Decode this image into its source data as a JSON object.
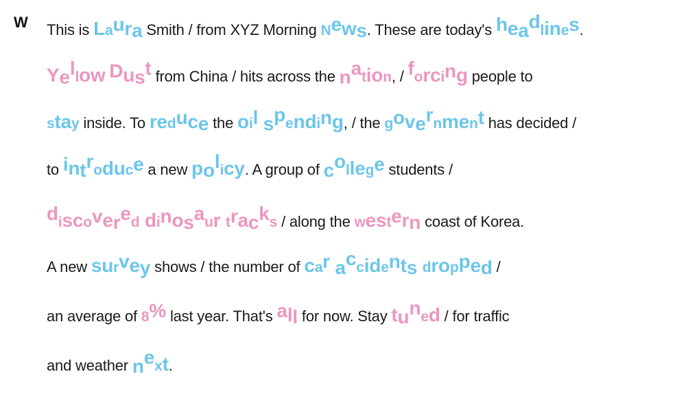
{
  "speaker": "W",
  "lines": [
    [
      {
        "t": "This is ",
        "c": "n"
      },
      {
        "t": "Laura",
        "c": "b"
      },
      {
        "t": " Smith / from XYZ Morning ",
        "c": "n"
      },
      {
        "t": "News",
        "c": "b"
      },
      {
        "t": ". These are today's ",
        "c": "n"
      },
      {
        "t": "headlines",
        "c": "b"
      },
      {
        "t": ".",
        "c": "n"
      }
    ],
    [
      {
        "t": "Yellow Dust",
        "c": "p"
      },
      {
        "t": " from China / hits across the ",
        "c": "n"
      },
      {
        "t": "nation",
        "c": "p"
      },
      {
        "t": ", / ",
        "c": "n"
      },
      {
        "t": "forcing",
        "c": "p"
      },
      {
        "t": " people to",
        "c": "n"
      }
    ],
    [
      {
        "t": "stay",
        "c": "b"
      },
      {
        "t": " inside. To ",
        "c": "n"
      },
      {
        "t": "reduce",
        "c": "b"
      },
      {
        "t": " the ",
        "c": "n"
      },
      {
        "t": "oil spending",
        "c": "b"
      },
      {
        "t": ", / the ",
        "c": "n"
      },
      {
        "t": "government",
        "c": "b"
      },
      {
        "t": " has decided /",
        "c": "n"
      }
    ],
    [
      {
        "t": "to ",
        "c": "n"
      },
      {
        "t": "introduce",
        "c": "b"
      },
      {
        "t": " a new ",
        "c": "n"
      },
      {
        "t": "policy",
        "c": "b"
      },
      {
        "t": ". A group of ",
        "c": "n"
      },
      {
        "t": "college",
        "c": "b"
      },
      {
        "t": " students /",
        "c": "n"
      }
    ],
    [
      {
        "t": "discovered dinosaur tracks",
        "c": "p"
      },
      {
        "t": " / along the ",
        "c": "n"
      },
      {
        "t": "western",
        "c": "p"
      },
      {
        "t": " coast of Korea.",
        "c": "n"
      }
    ],
    [
      {
        "t": "A new ",
        "c": "n"
      },
      {
        "t": "survey",
        "c": "b"
      },
      {
        "t": " shows / the number of ",
        "c": "n"
      },
      {
        "t": "car accidents dropped",
        "c": "b"
      },
      {
        "t": " /",
        "c": "n"
      }
    ],
    [
      {
        "t": "an average of ",
        "c": "n"
      },
      {
        "t": "8%",
        "c": "p"
      },
      {
        "t": " last year. That's ",
        "c": "n"
      },
      {
        "t": "all",
        "c": "p"
      },
      {
        "t": " for now. Stay ",
        "c": "n"
      },
      {
        "t": "tuned",
        "c": "p"
      },
      {
        "t": " / for traffic",
        "c": "n"
      }
    ],
    [
      {
        "t": "and weather ",
        "c": "n"
      },
      {
        "t": "next",
        "c": "b"
      },
      {
        "t": ".",
        "c": "n"
      }
    ]
  ]
}
